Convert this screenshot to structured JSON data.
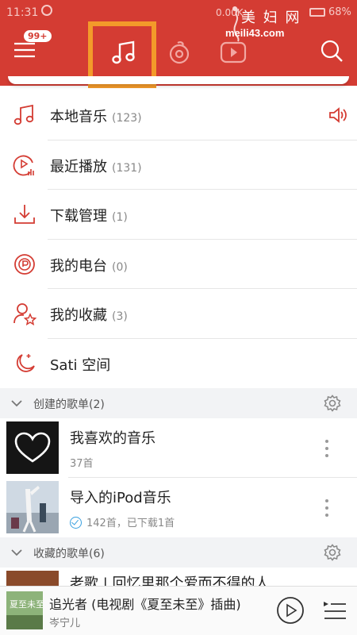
{
  "status_bar": {
    "time": "11:31",
    "speed": "0.00K",
    "battery": "68%"
  },
  "watermark": {
    "title": "美 妇 网",
    "url": "meili43.com"
  },
  "header": {
    "badge": "99+",
    "tabs": [
      "music-note-icon",
      "radio-icon",
      "video-icon"
    ],
    "accent_color": "#d43c33",
    "highlight_color": "#f39a2a"
  },
  "menu": {
    "items": [
      {
        "label": "本地音乐",
        "count": "(123)",
        "icon": "music-note-icon"
      },
      {
        "label": "最近播放",
        "count": "(131)",
        "icon": "recent-play-icon"
      },
      {
        "label": "下载管理",
        "count": "(1)",
        "icon": "download-icon"
      },
      {
        "label": "我的电台",
        "count": "(0)",
        "icon": "radio-station-icon"
      },
      {
        "label": "我的收藏",
        "count": "(3)",
        "icon": "favorite-user-icon"
      },
      {
        "label": "Sati 空间",
        "count": "",
        "icon": "moon-icon"
      }
    ]
  },
  "created_section": {
    "title": "创建的歌单(2)"
  },
  "playlists": [
    {
      "name": "我喜欢的音乐",
      "sub": "37首"
    },
    {
      "name": "导入的iPod音乐",
      "sub": "142首，已下载1首"
    }
  ],
  "collected_section": {
    "title": "收藏的歌单(6)"
  },
  "collected_playlists": [
    {
      "name": "老歌 | 回忆里那个爱而不得的人"
    }
  ],
  "player": {
    "song": "追光者 (电视剧《夏至未至》插曲)",
    "artist": "岑宁儿"
  }
}
